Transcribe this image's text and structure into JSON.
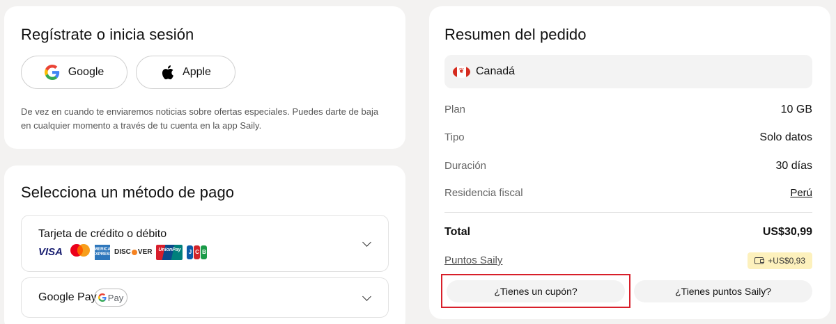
{
  "signup": {
    "title": "Regístrate o inicia sesión",
    "google_label": "Google",
    "apple_label": "Apple",
    "note": "De vez en cuando te enviaremos noticias sobre ofertas especiales. Puedes darte de baja en cualquier momento a través de tu cuenta en la app Saily."
  },
  "payment": {
    "title": "Selecciona un método de pago",
    "card_option": {
      "label": "Tarjeta de crédito o débito",
      "logos": [
        "VISA",
        "Mastercard",
        "AMEX",
        "DISCOVER",
        "UnionPay",
        "JCB"
      ],
      "amex_text": "AMERICAN EXPRESS",
      "visa_text": "VISA",
      "discover_text": [
        "DISC",
        "VER"
      ],
      "unionpay_text": "UnionPay",
      "jcb_letters": [
        "J",
        "C",
        "B"
      ]
    },
    "gpay_option": {
      "label": "Google Pay",
      "badge_text": "Pay"
    }
  },
  "summary": {
    "title": "Resumen del pedido",
    "country": "Canadá",
    "rows": [
      {
        "key": "Plan",
        "value": "10 GB"
      },
      {
        "key": "Tipo",
        "value": "Solo datos"
      },
      {
        "key": "Duración",
        "value": "30 días"
      },
      {
        "key": "Residencia fiscal",
        "value": "Perú"
      }
    ],
    "total_label": "Total",
    "total_value": "US$30,99",
    "points_label": "Puntos Saily",
    "points_value": "+US$0,93",
    "coupon_button": "¿Tienes un cupón?",
    "points_button": "¿Tienes puntos Saily?"
  },
  "colors": {
    "background": "#f3f2f1",
    "highlight_border": "#d81f2a",
    "points_badge": "#fdf1bd"
  }
}
